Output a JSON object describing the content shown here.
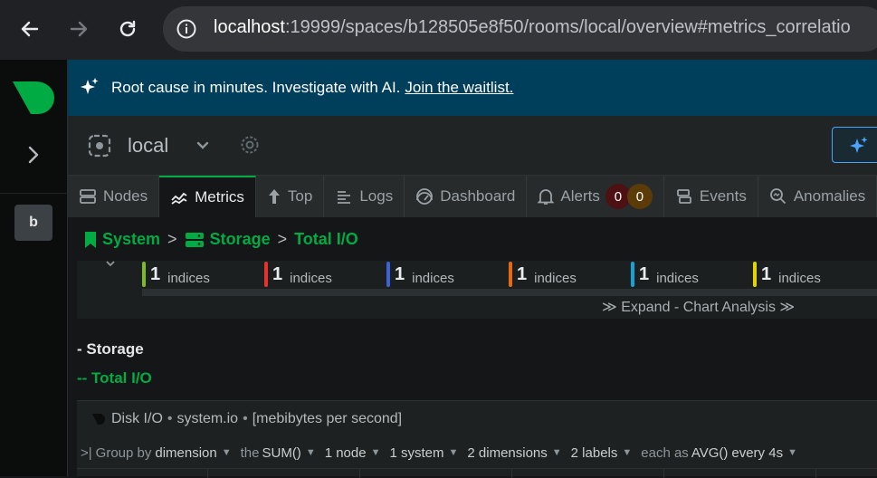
{
  "browser": {
    "url_host": "localhost",
    "url_rest": ":19999/spaces/b128505e8f50/rooms/local/overview#metrics_correlatio"
  },
  "rail": {
    "space_letter": "b"
  },
  "banner": {
    "text": "Root cause in minutes. Investigate with AI.",
    "link": "Join the waitlist."
  },
  "room": {
    "name": "local"
  },
  "tabs": [
    {
      "label": "Nodes",
      "icon": "nodes-icon"
    },
    {
      "label": "Metrics",
      "icon": "metrics-icon"
    },
    {
      "label": "Top",
      "icon": "top-icon"
    },
    {
      "label": "Logs",
      "icon": "logs-icon"
    },
    {
      "label": "Dashboard",
      "icon": "dashboard-icon"
    },
    {
      "label": "Alerts",
      "icon": "bell-icon"
    },
    {
      "label": "Events",
      "icon": "events-icon"
    },
    {
      "label": "Anomalies",
      "icon": "anomalies-icon"
    }
  ],
  "alerts": {
    "critical": "0",
    "warning": "0"
  },
  "breadcrumb": {
    "system": "System",
    "storage": "Storage",
    "total_io": "Total I/O",
    "sep": ">"
  },
  "correlations": {
    "indices": [
      {
        "count": "1",
        "label": "indices",
        "color": "#7cbb22"
      },
      {
        "count": "1",
        "label": "indices",
        "color": "#e5322d"
      },
      {
        "count": "1",
        "label": "indices",
        "color": "#3c63d6"
      },
      {
        "count": "1",
        "label": "indices",
        "color": "#e66a12"
      },
      {
        "count": "1",
        "label": "indices",
        "color": "#14a3d6"
      },
      {
        "count": "1",
        "label": "indices",
        "color": "#e3d400"
      }
    ],
    "expand_label": "Expand - Chart Analysis"
  },
  "sections": {
    "storage": "- Storage",
    "total_io": "-- Total I/O"
  },
  "chart": {
    "title": "Disk I/O",
    "context": "system.io",
    "units": "[mebibytes per second]",
    "controls": {
      "group_by": "Group by",
      "dimension": "dimension",
      "the": "the",
      "sum": "SUM()",
      "nodes": "1 node",
      "systems": "1 system",
      "dimensions": "2 dimensions",
      "labels": "2 labels",
      "each_as": "each as",
      "avg": "AVG()",
      "every": "every 4s"
    }
  },
  "colors": {
    "accent": "#00ab44",
    "banner_bg": "#003f5c"
  }
}
